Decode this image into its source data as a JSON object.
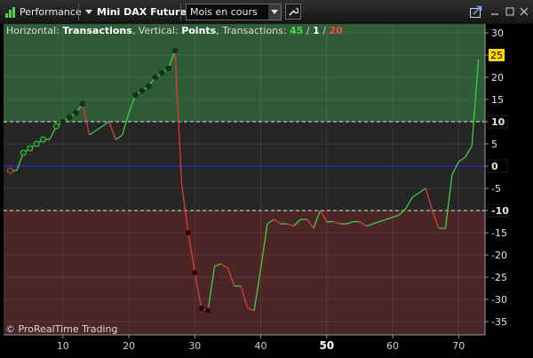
{
  "window": {
    "app_title": "Performance",
    "instrument": "Mini DAX Future",
    "period": "Mois en cours"
  },
  "chart_header": {
    "prefix_h": "Horizontal: ",
    "horizontal": "Transactions",
    "prefix_v": ", Vertical: ",
    "vertical": "Points",
    "prefix_t": ", Transactions: ",
    "count_total": "45",
    "slash1": " / ",
    "count_neutral": "1",
    "slash2": " / ",
    "count_loss": "20"
  },
  "watermark": "© ProRealTime Trading",
  "colors": {
    "profit_zone": "#2f5c36",
    "loss_zone": "#4c2626",
    "neutral_zone": "#262626",
    "gain_line": "#3fcf3f",
    "loss_line": "#e03a3a",
    "zero_line": "#2a2ad8",
    "highlight": "#ffd800",
    "count_total": "#52d652",
    "count_loss": "#ff4a4a"
  },
  "chart_data": {
    "type": "line",
    "xlim": [
      1,
      74
    ],
    "ylim": [
      -38,
      32
    ],
    "x_ticks": [
      "10",
      "20",
      "30",
      "40",
      "50",
      "60",
      "70"
    ],
    "x_highlight": "50",
    "y_ticks": [
      "30",
      "25",
      "20",
      "15",
      "10",
      "5",
      "0",
      "-5",
      "-10",
      "-15",
      "-20",
      "-25",
      "-30",
      "-35"
    ],
    "y_highlight": "25",
    "y_boxed": [
      "10",
      "0",
      "-10"
    ],
    "upper_band": 10,
    "lower_band": -10,
    "zero": 0,
    "points": [
      [
        2,
        -1
      ],
      [
        3,
        -1
      ],
      [
        4,
        3
      ],
      [
        5,
        4
      ],
      [
        6,
        5
      ],
      [
        7,
        6
      ],
      [
        8,
        6
      ],
      [
        9,
        9
      ],
      [
        10,
        10
      ],
      [
        11,
        11
      ],
      [
        12,
        12
      ],
      [
        13,
        14
      ],
      [
        14,
        7
      ],
      [
        15,
        8
      ],
      [
        16,
        9
      ],
      [
        17,
        10
      ],
      [
        18,
        6
      ],
      [
        19,
        7
      ],
      [
        20,
        12
      ],
      [
        21,
        16
      ],
      [
        22,
        17
      ],
      [
        23,
        18
      ],
      [
        24,
        20
      ],
      [
        25,
        21
      ],
      [
        26,
        22
      ],
      [
        27,
        26
      ],
      [
        28,
        -4
      ],
      [
        29,
        -15
      ],
      [
        30,
        -24
      ],
      [
        31,
        -32
      ],
      [
        32,
        -32.5
      ],
      [
        33,
        -22.5
      ],
      [
        34,
        -22
      ],
      [
        35,
        -23
      ],
      [
        36,
        -27
      ],
      [
        37,
        -27
      ],
      [
        38,
        -32
      ],
      [
        39,
        -32.5
      ],
      [
        40,
        -23
      ],
      [
        41,
        -13
      ],
      [
        42,
        -12
      ],
      [
        43,
        -13
      ],
      [
        44,
        -13
      ],
      [
        45,
        -13.5
      ],
      [
        46,
        -12
      ],
      [
        47,
        -12
      ],
      [
        48,
        -14
      ],
      [
        49,
        -10
      ],
      [
        50,
        -12.5
      ],
      [
        51,
        -12.5
      ],
      [
        52,
        -13
      ],
      [
        53,
        -13
      ],
      [
        54,
        -12.5
      ],
      [
        55,
        -12.5
      ],
      [
        56,
        -13.5
      ],
      [
        57,
        -13
      ],
      [
        58,
        -12.5
      ],
      [
        59,
        -12
      ],
      [
        60,
        -11.5
      ],
      [
        61,
        -11
      ],
      [
        62,
        -9.5
      ],
      [
        63,
        -7
      ],
      [
        64,
        -6
      ],
      [
        65,
        -5
      ],
      [
        66,
        -10
      ],
      [
        67,
        -14
      ],
      [
        68,
        -14
      ],
      [
        69,
        -2
      ],
      [
        70,
        1
      ],
      [
        71,
        2
      ],
      [
        72,
        4.5
      ],
      [
        73,
        24
      ]
    ],
    "markers": [
      {
        "x": 2,
        "y": -1,
        "kind": "loss-open"
      },
      {
        "x": 4,
        "y": 3,
        "kind": "gain-open"
      },
      {
        "x": 5,
        "y": 4,
        "kind": "gain-open"
      },
      {
        "x": 6,
        "y": 5,
        "kind": "gain-open"
      },
      {
        "x": 7,
        "y": 6,
        "kind": "gain-open"
      },
      {
        "x": 9,
        "y": 9,
        "kind": "gain-open"
      },
      {
        "x": 10,
        "y": 10,
        "kind": "gain-filled"
      },
      {
        "x": 11,
        "y": 11,
        "kind": "gain-filled"
      },
      {
        "x": 12,
        "y": 12,
        "kind": "gain-filled"
      },
      {
        "x": 13,
        "y": 14,
        "kind": "gain-filled"
      },
      {
        "x": 21,
        "y": 16,
        "kind": "gain-filled"
      },
      {
        "x": 22,
        "y": 17,
        "kind": "gain-filled"
      },
      {
        "x": 23,
        "y": 18,
        "kind": "gain-filled"
      },
      {
        "x": 24,
        "y": 20,
        "kind": "gain-filled"
      },
      {
        "x": 25,
        "y": 21,
        "kind": "gain-filled"
      },
      {
        "x": 26,
        "y": 22,
        "kind": "gain-filled"
      },
      {
        "x": 27,
        "y": 26,
        "kind": "gain-filled"
      },
      {
        "x": 29,
        "y": -15,
        "kind": "loss-filled"
      },
      {
        "x": 30,
        "y": -24,
        "kind": "loss-filled"
      },
      {
        "x": 31,
        "y": -32,
        "kind": "loss-filled"
      },
      {
        "x": 32,
        "y": -32.5,
        "kind": "loss-filled"
      }
    ]
  }
}
